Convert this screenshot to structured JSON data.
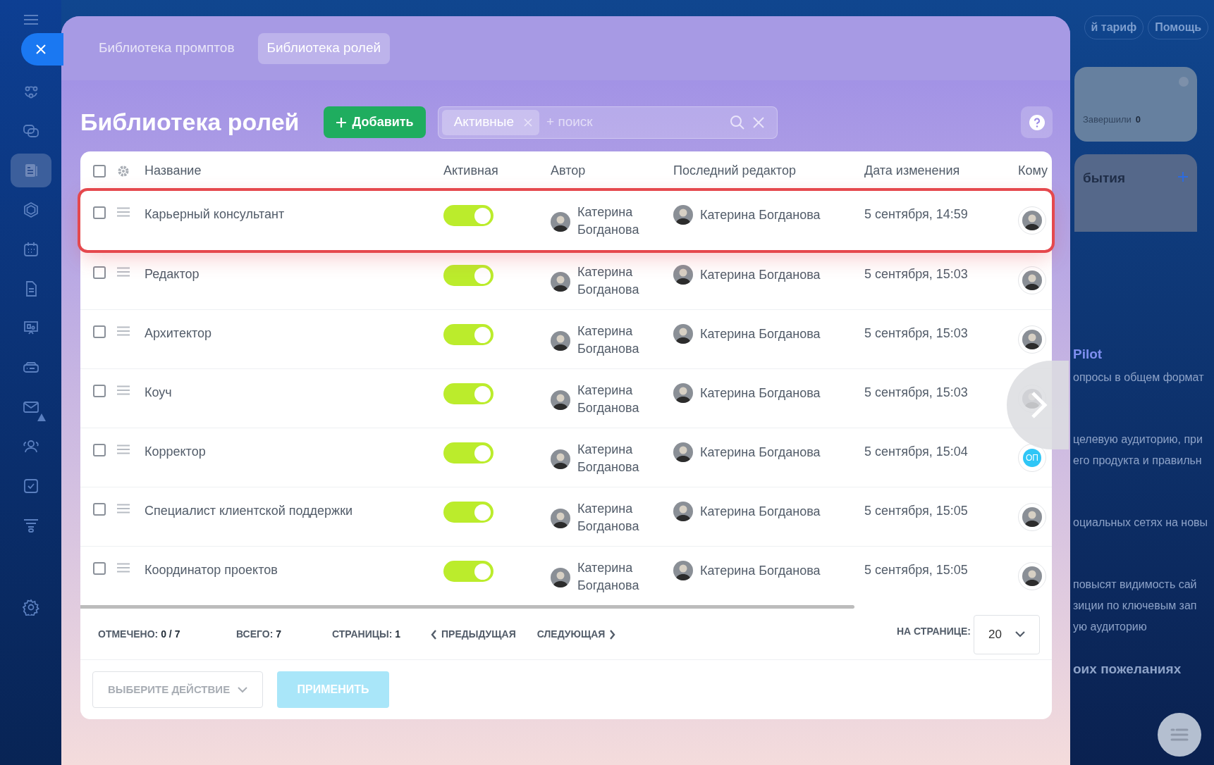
{
  "sidebar": {
    "items": [
      {
        "selected": false,
        "warning": false
      },
      {
        "selected": false,
        "warning": false
      },
      {
        "selected": true,
        "warning": false
      },
      {
        "selected": false,
        "warning": false
      },
      {
        "selected": false,
        "warning": false
      },
      {
        "selected": false,
        "warning": false
      },
      {
        "selected": false,
        "warning": false
      },
      {
        "selected": false,
        "warning": false
      },
      {
        "selected": false,
        "warning": true
      },
      {
        "selected": false,
        "warning": false
      },
      {
        "selected": false,
        "warning": false
      },
      {
        "selected": false,
        "warning": false
      },
      {
        "selected": false,
        "warning": false
      }
    ]
  },
  "backdrop": {
    "top_buttons": [
      "й тариф",
      "Помощь"
    ],
    "card": {
      "label": "Завершили",
      "value": "0"
    },
    "section_title": "бытия",
    "texts": [
      {
        "kind": "heading",
        "text": "Pilot"
      },
      {
        "kind": "line",
        "text": "опросы в общем формат"
      },
      {
        "kind": "gap",
        "text": "целевую аудиторию, при"
      },
      {
        "kind": "line",
        "text": "его продукта и правильн"
      },
      {
        "kind": "gap",
        "text": "оциальных сетях на новы"
      },
      {
        "kind": "gap",
        "text": "повысят видимость сай"
      },
      {
        "kind": "line",
        "text": "зиции по ключевым зап"
      },
      {
        "kind": "line",
        "text": "ую аудиторию"
      },
      {
        "kind": "heading2",
        "text": "оих пожеланиях"
      }
    ]
  },
  "panel": {
    "tabs": [
      {
        "label": "Библиотека промптов",
        "selected": false
      },
      {
        "label": "Библиотека ролей",
        "selected": true
      }
    ],
    "title": "Библиотека ролей",
    "add_button": "Добавить",
    "filter": {
      "tag": "Активные",
      "placeholder": "+ поиск"
    },
    "table": {
      "all_checked": false,
      "columns": [
        "Название",
        "Активная",
        "Автор",
        "Последний редактор",
        "Дата изменения",
        "Кому"
      ],
      "rows": [
        {
          "checked": false,
          "highlighted": true,
          "name": "Карьерный консультант",
          "active": true,
          "author": "Катерина Богданова",
          "editor": "Катерина Богданова",
          "date": "5 сентября, 14:59",
          "recipient": {
            "kind": "photo"
          }
        },
        {
          "checked": false,
          "highlighted": false,
          "name": "Редактор",
          "active": true,
          "author": "Катерина Богданова",
          "editor": "Катерина Богданова",
          "date": "5 сентября, 15:03",
          "recipient": {
            "kind": "photo"
          }
        },
        {
          "checked": false,
          "highlighted": false,
          "name": "Архитектор",
          "active": true,
          "author": "Катерина Богданова",
          "editor": "Катерина Богданова",
          "date": "5 сентября, 15:03",
          "recipient": {
            "kind": "photo"
          }
        },
        {
          "checked": false,
          "highlighted": false,
          "name": "Коуч",
          "active": true,
          "author": "Катерина Богданова",
          "editor": "Катерина Богданова",
          "date": "5 сентября, 15:03",
          "recipient": {
            "kind": "photo"
          }
        },
        {
          "checked": false,
          "highlighted": false,
          "name": "Корректор",
          "active": true,
          "author": "Катерина Богданова",
          "editor": "Катерина Богданова",
          "date": "5 сентября, 15:04",
          "recipient": {
            "kind": "initials",
            "text": "ОП"
          }
        },
        {
          "checked": false,
          "highlighted": false,
          "name": "Специалист клиентской поддержки",
          "active": true,
          "author": "Катерина Богданова",
          "editor": "Катерина Богданова",
          "date": "5 сентября, 15:05",
          "recipient": {
            "kind": "photo"
          }
        },
        {
          "checked": false,
          "highlighted": false,
          "name": "Координатор проектов",
          "active": true,
          "author": "Катерина Богданова",
          "editor": "Катерина Богданова",
          "date": "5 сентября, 15:05",
          "recipient": {
            "kind": "photo"
          }
        }
      ]
    },
    "footer": {
      "checked_label": "ОТМЕЧЕНО:",
      "checked_value": "0 / 7",
      "total_label": "ВСЕГО:",
      "total_value": "7",
      "pages_label": "СТРАНИЦЫ:",
      "pages_value": "1",
      "prev": "ПРЕДЫДУЩАЯ",
      "next": "СЛЕДУЮЩАЯ",
      "per_page_label": "НА СТРАНИЦЕ:",
      "per_page": "20"
    },
    "actions": {
      "select_placeholder": "ВЫБЕРИТЕ ДЕЙСТВИЕ",
      "apply": "ПРИМЕНИТЬ",
      "apply_disabled": true
    }
  }
}
